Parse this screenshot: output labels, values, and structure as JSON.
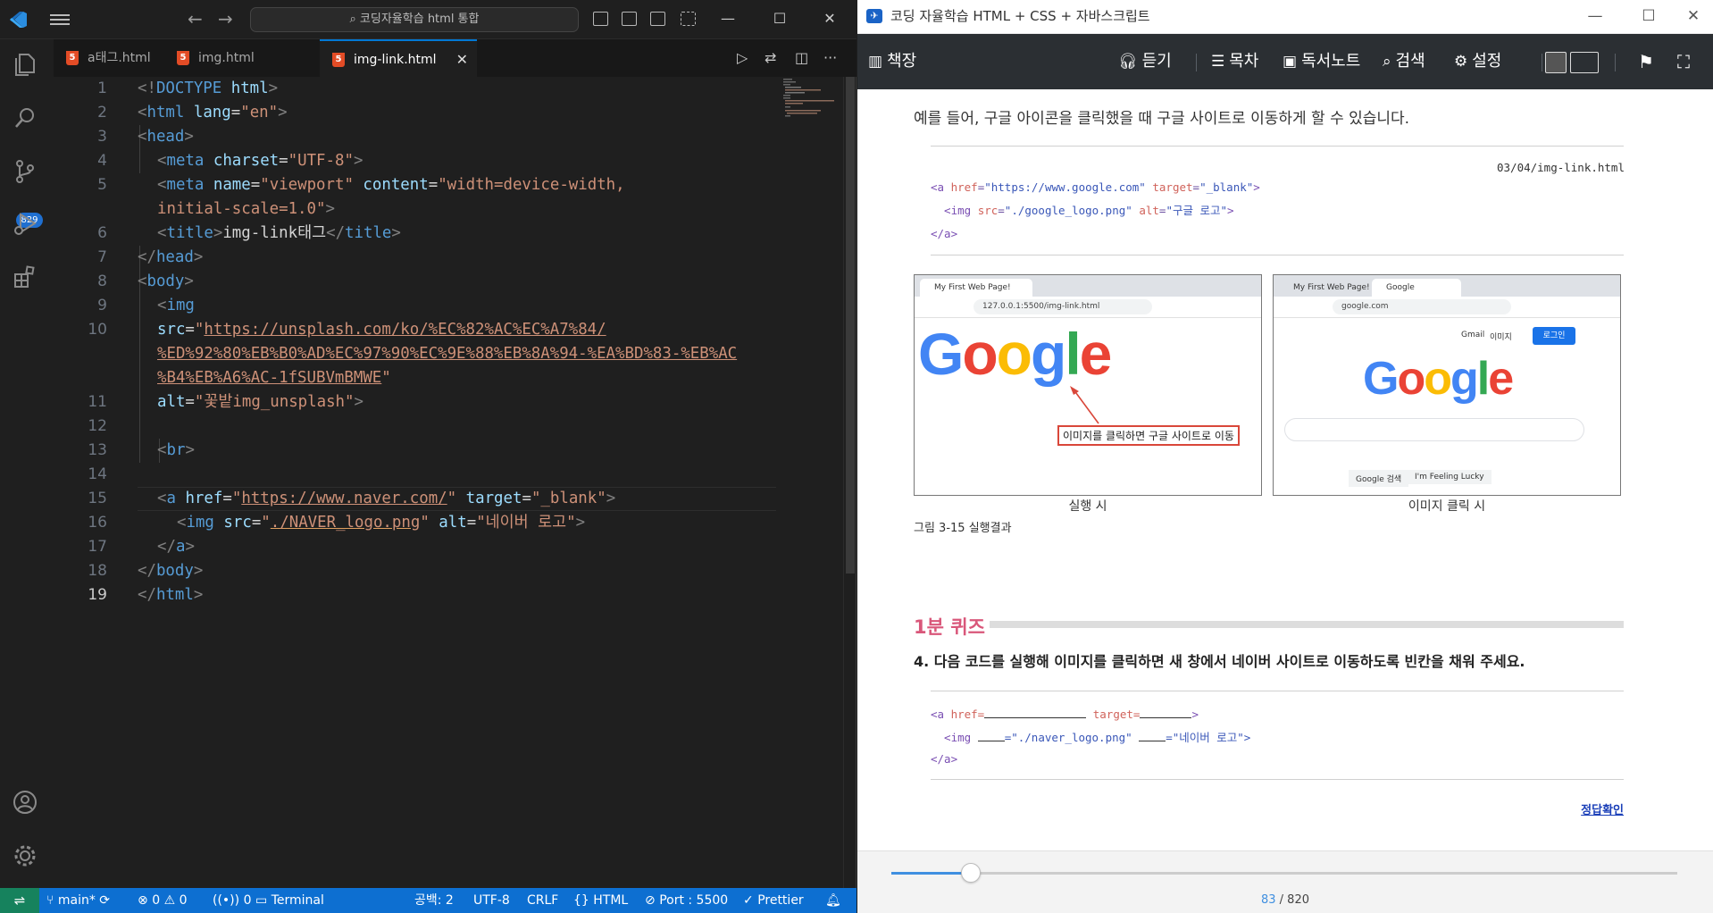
{
  "vscode": {
    "search_text": "코딩자율학습 html 통합",
    "scm_badge": "829",
    "tabs": [
      {
        "label": "a태그.html"
      },
      {
        "label": "img.html"
      },
      {
        "label": "img-link.html"
      }
    ],
    "line_numbers": [
      "1",
      "2",
      "3",
      "4",
      "5",
      "",
      "6",
      "7",
      "8",
      "9",
      "10",
      "",
      "",
      "11",
      "12",
      "13",
      "14",
      "15",
      "16",
      "17",
      "18",
      "19"
    ],
    "code": {
      "l1_a": "<!",
      "l1_b": "DOCTYPE",
      "l1_c": " html",
      "l1_d": ">",
      "l2_tag": "html",
      "l2_attr": "lang",
      "l2_val": "\"en\"",
      "l3_tag": "head",
      "l4_tag": "meta",
      "l4_attr": "charset",
      "l4_val": "\"UTF-8\"",
      "l5_tag": "meta",
      "l5_attr1": "name",
      "l5_val1": "\"viewport\"",
      "l5_attr2": "content",
      "l5_val2a": "\"width=device-width,",
      "l5_val2b": "initial-scale=1.0\"",
      "l6_tag": "title",
      "l6_text": "img-link태그",
      "l7_tag": "head",
      "l8_tag": "body",
      "l9_tag": "img",
      "l10_attr": "src",
      "l10_q": "\"",
      "l10_url_a": "https://unsplash.com/ko/%EC%82%AC%EC%A7%84/",
      "l10_url_b": "%ED%92%80%EB%B0%AD%EC%97%90%EC%9E%88%EB%8A%94-%EA%BD%83-%EB%AC",
      "l10_url_c": "%B4%EB%A6%AC-1fSUBVmBMWE",
      "l11_attr": "alt",
      "l11_val": "\"꽃밭img_unsplash\"",
      "l13_tag": "br",
      "l15_tag": "a",
      "l15_attr1": "href",
      "l15_url": "https://www.naver.com/",
      "l15_attr2": "target",
      "l15_val2": "\"_blank\"",
      "l16_tag": "img",
      "l16_attr1": "src",
      "l16_src": "./NAVER_logo.png",
      "l16_attr2": "alt",
      "l16_val2": "\"네이버 로고\"",
      "l17_tag": "a",
      "l18_tag": "body",
      "l19_tag": "html"
    },
    "status": {
      "branch": "main*",
      "errors": "0",
      "warnings": "0",
      "ports": "0",
      "terminal": "Terminal",
      "spaces": "공백: 2",
      "encoding": "UTF-8",
      "eol": "CRLF",
      "language": "HTML",
      "port": "Port : 5500",
      "prettier": "Prettier"
    }
  },
  "reader": {
    "window_title": "코딩 자율학습 HTML + CSS + 자바스크립트",
    "toolbar": {
      "bookshelf": "책장",
      "listen": "듣기",
      "toc": "목차",
      "notes": "독서노트",
      "search": "검색",
      "settings": "설정"
    },
    "intro": "예를 들어, 구글 아이콘을 클릭했을 때 구글 사이트로 이동하게 할 수 있습니다.",
    "example_file": "03/04/img-link.html",
    "example": {
      "a_open": "<a ",
      "href_attr": "href",
      "href_val": "\"https://www.google.com\"",
      "target_attr": "target",
      "target_val": "\"_blank\"",
      "close": ">",
      "img_open": "  <img ",
      "src_attr": "src",
      "src_val": "\"./google_logo.png\"",
      "alt_attr": "alt",
      "alt_val": "\"구글 로고\"",
      "a_close": "</a>"
    },
    "fig_left": {
      "tab": "My First Web Page!",
      "url": "127.0.0.1:5500/img-link.html",
      "callout": "이미지를 클릭하면 구글 사이트로 이동",
      "caption": "실행 시"
    },
    "fig_right": {
      "tab1": "My First Web Page!",
      "tab2": "Google",
      "url": "google.com",
      "gmail": "Gmail",
      "images": "이미지",
      "login": "로그인",
      "btn_search": "Google 검색",
      "btn_lucky": "I'm Feeling Lucky",
      "caption": "이미지 클릭 시"
    },
    "logo": [
      "G",
      "o",
      "o",
      "g",
      "l",
      "e"
    ],
    "figure_label": "그림 3-15 실행결과",
    "quiz_title": "1분 퀴즈",
    "quiz_question": "4. 다음 코드를 실행해 이미지를 클릭하면 새 창에서 네이버 사이트로 이동하도록 빈칸을 채워 주세요.",
    "quiz_code": {
      "a_open": "<a ",
      "href_attr": "href=",
      "target_attr": "target=",
      "close": ">",
      "img_open": "  <img ",
      "eq1": "=\"./naver_logo.png\" ",
      "eq2": "=\"네이버 로고\">",
      "a_close": "</a>"
    },
    "answer_link": "정답확인",
    "page_current": "83",
    "page_total": "/ 820",
    "progress": 0.101
  }
}
